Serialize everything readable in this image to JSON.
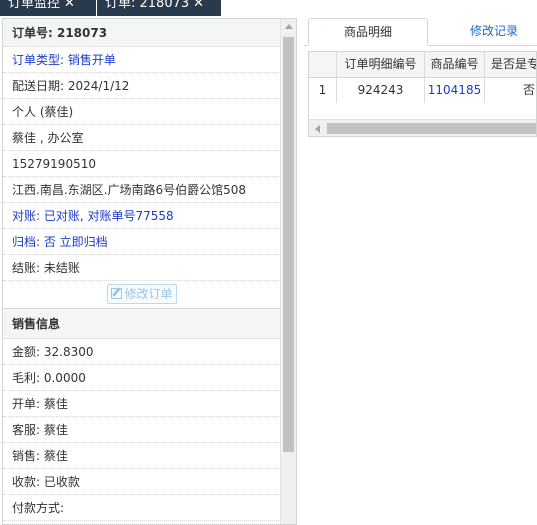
{
  "top_tabs": [
    {
      "label": "订单监控",
      "close": "✕"
    },
    {
      "label": "订单: 218073",
      "close": "✕"
    }
  ],
  "order_info": {
    "header": "订单号: 218073",
    "rows": [
      {
        "text": "订单类型: 销售开单",
        "style": "blue"
      },
      {
        "text": "配送日期: 2024/1/12",
        "style": "normal"
      },
      {
        "text": "个人 (蔡佳)",
        "style": "normal"
      },
      {
        "text": "蔡佳 , 办公室",
        "style": "normal"
      },
      {
        "text": "15279190510",
        "style": "normal"
      },
      {
        "text": "江西.南昌.东湖区.广场南路6号伯爵公馆508",
        "style": "normal"
      },
      {
        "text": "对账: 已对账, 对账单号77558",
        "style": "blue"
      },
      {
        "text": "归档: 否 立即归档",
        "style": "blue"
      },
      {
        "text": "结账: 未结账",
        "style": "normal"
      }
    ],
    "edit_button": "修改订单"
  },
  "sales_info": {
    "header": "销售信息",
    "rows": [
      "金额: 32.8300",
      "毛利: 0.0000",
      "开单: 蔡佳",
      "客服: 蔡佳",
      "销售: 蔡佳",
      "收款: 已收款",
      "付款方式:"
    ]
  },
  "detail_tabs": {
    "active": "商品明细",
    "inactive": "修改记录"
  },
  "detail_grid": {
    "columns": [
      "",
      "订单明细编号",
      "商品编号",
      "是否是专"
    ],
    "rows": [
      {
        "index": "1",
        "detail_id": "924243",
        "product_id": "1104185",
        "flag": "否"
      }
    ]
  }
}
